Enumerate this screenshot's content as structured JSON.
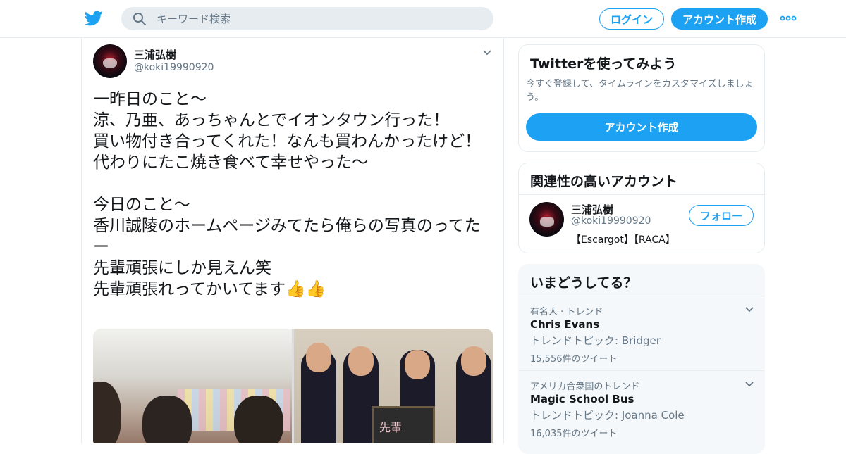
{
  "header": {
    "logo_icon": "twitter-bird-icon",
    "search_placeholder": "キーワード検索",
    "login_label": "ログイン",
    "signup_label": "アカウント作成",
    "brand_color": "#1da1f2"
  },
  "tweet": {
    "author_name": "三浦弘樹",
    "author_handle": "@koki19990920",
    "text": "一昨日のこと～\n涼、乃亜、あっちゃんとでイオンタウン行った！\n買い物付き合ってくれた！なんも買わんかったけど！\n代わりにたこ焼き食べて幸せやった～\n\n今日のこと～\n香川誠陵のホームページみてたら俺らの写真のってたー\n先輩頑張にしか見えん笑\n先輩頑張れってかいてます👍👍",
    "photo_board_text": "先輩"
  },
  "signup_card": {
    "title": "Twitterを使ってみよう",
    "description": "今すぐ登録して、タイムラインをカスタマイズしましょう。",
    "button_label": "アカウント作成"
  },
  "related": {
    "title": "関連性の高いアカウント",
    "name": "三浦弘樹",
    "handle": "@koki19990920",
    "bio": "【Escargot】【RACA】",
    "follow_label": "フォロー"
  },
  "trends": {
    "title": "いまどうしてる？",
    "items": [
      {
        "meta": "有名人 · トレンド",
        "name": "Chris Evans",
        "topic": "トレンドトピック: Bridger",
        "count": "15,556件のツイート"
      },
      {
        "meta": "アメリカ合衆国のトレンド",
        "name": "Magic School Bus",
        "topic": "トレンドトピック: Joanna Cole",
        "count": "16,035件のツイート"
      }
    ]
  }
}
